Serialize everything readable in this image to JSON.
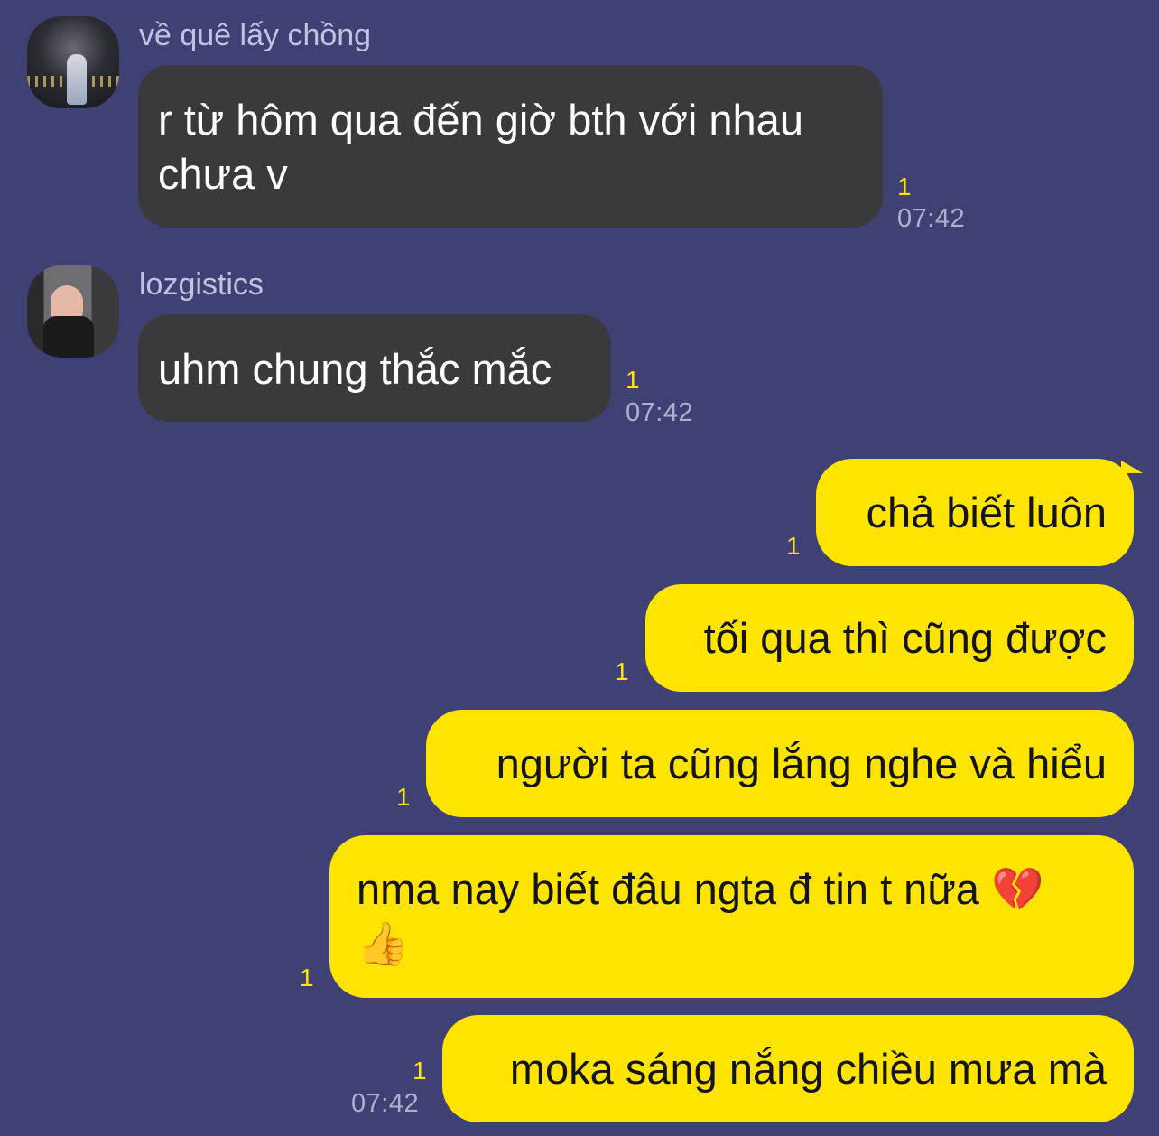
{
  "chat": {
    "messages": [
      {
        "sender": "về quê lấy chồng",
        "lines": [
          "r từ hôm qua đến giờ bth với nhau",
          "chưa v"
        ],
        "unread": "1",
        "time": "07:42"
      },
      {
        "sender": "lozgistics",
        "lines": [
          "uhm chung thắc mắc"
        ],
        "unread": "1",
        "time": "07:42"
      }
    ],
    "outgoing": [
      {
        "lines": [
          "chả biết luôn"
        ],
        "unread": "1"
      },
      {
        "lines": [
          "tối qua thì cũng được"
        ],
        "unread": "1"
      },
      {
        "lines": [
          "người ta cũng lắng nghe và hiểu"
        ],
        "unread": "1"
      },
      {
        "lines": [
          "nma nay biết đâu ngta đ tin t nữa 💔",
          "👍"
        ],
        "unread": "1"
      },
      {
        "lines": [
          "moka sáng nắng chiều mưa mà"
        ],
        "unread": "1",
        "time": "07:42"
      }
    ]
  },
  "colors": {
    "background": "#3f4175",
    "incoming_bubble": "#3a3a3d",
    "outgoing_bubble": "#ffe400",
    "unread_count": "#ffe400"
  }
}
